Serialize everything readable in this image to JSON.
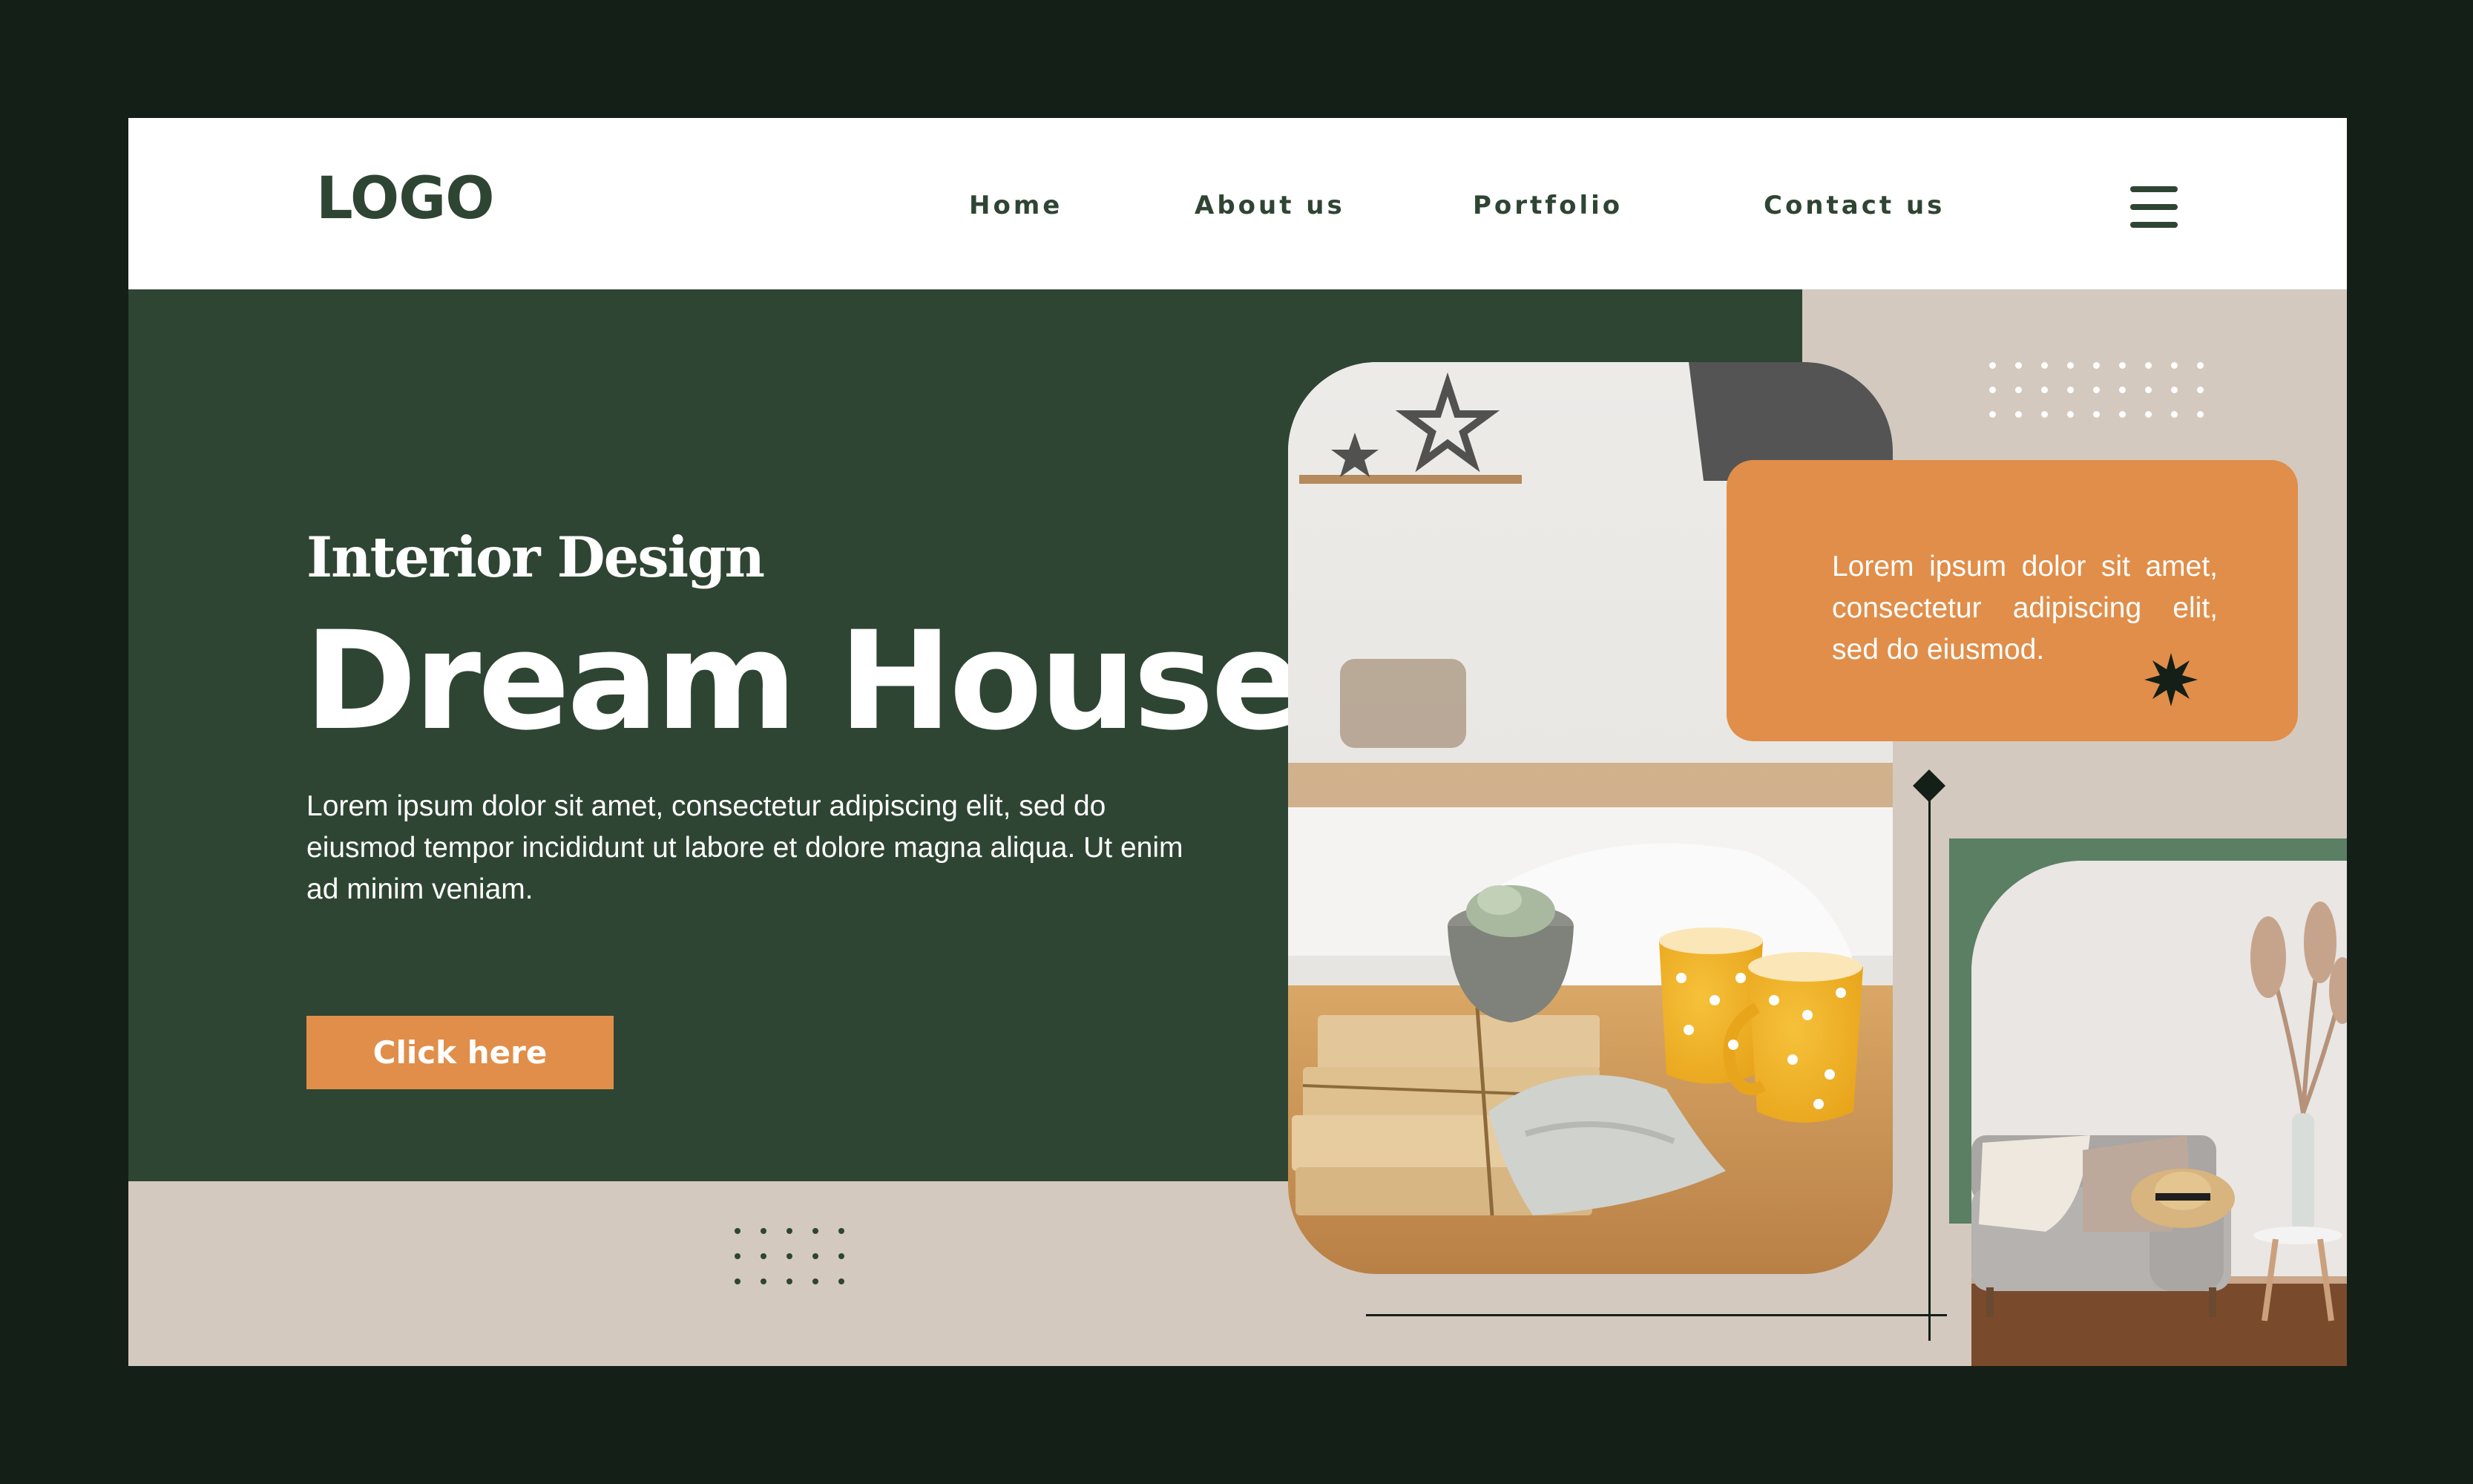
{
  "nav": {
    "logo": "LOGO",
    "links": [
      "Home",
      "About us",
      "Portfolio",
      "Contact us"
    ],
    "menu_icon": "hamburger-menu-icon"
  },
  "hero": {
    "eyebrow": "Interior Design",
    "title": "Dream House",
    "description": "Lorem ipsum dolor sit amet, consectetur adipiscing elit, sed do eiusmod tempor incididunt ut labore et dolore magna aliqua. Ut enim ad minim veniam.",
    "cta_label": "Click here"
  },
  "promo": {
    "text": "Lorem ipsum dolor sit amet, consectetur adipiscing elit, sed do eiusmod.",
    "icon": "starburst-icon"
  },
  "images": {
    "main_photo": "kitchen-table-photo",
    "side_photo": "living-room-sofa-photo"
  },
  "colors": {
    "dark_green": "#2f4533",
    "orange": "#e08e4a",
    "beige": "#d3c9bf",
    "frame": "#141f17",
    "sage_green": "#5b7f63"
  }
}
